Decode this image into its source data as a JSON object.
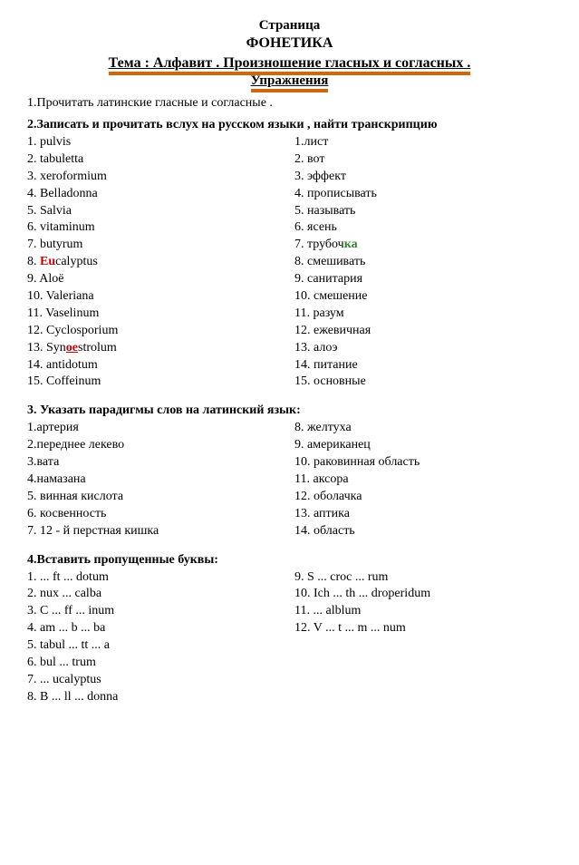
{
  "header": {
    "line1": "Страница",
    "line2": "ФОНЕТИКА",
    "line3": "Тема : Алфавит . Произношение гласных и согласных .",
    "line4": "Упражнения"
  },
  "task1": "1.Прочитать латинские гласные и согласные .",
  "task2": "2.Записать и прочитать вслух на русском языки , найти транскрипцию",
  "list1_left": [
    "1. pulvis",
    "2. tabuletta",
    "3. xeroformium",
    "4. Belladonna",
    "5. Salvia",
    "6. vitaminum",
    "7. butyrum",
    "9. Aloё",
    "10. Valeriana",
    "11. Vaselinum",
    "12. Cyclosporium",
    "14. antidotum",
    "15. Coffeinum"
  ],
  "list1_row8_left": "8. ",
  "list1_row8_r": "Eu",
  "list1_row8_rest": "calyptus",
  "list1_row13_left": "13. Syn",
  "list1_row13_u": "oe",
  "list1_row13_rest": "strolum",
  "list1_right": [
    "1.лист",
    "2. вот",
    "3. эффект",
    "4. прописывать",
    "5. называть",
    "6. ясень",
    "8. смешивать",
    "9. санитария",
    "10. смешение",
    "11. разум",
    "12. ежевичная",
    "13. алоэ",
    "14. питание",
    "15. основные"
  ],
  "list1_row7_right_pre": "7. трубоч",
  "list1_row7_right_g": "ка",
  "task3": "3. Указать парадигмы слов на латинский язык:",
  "list3_left": [
    "1.артерия",
    "2.переднее лекево",
    "3.вата",
    "4.намазана",
    "5. винная кислота",
    "6. косвенность",
    "7. 12 - й перстная кишка"
  ],
  "list3_right": [
    "8. желтуха",
    "9. американец",
    "10. раковинная область",
    "11. аксора",
    "12. оболачка",
    "13. аптика",
    "14. область"
  ],
  "task4": "4.Вставить пропущенные буквы:",
  "list4_left": [
    "1. ... ft ... dotum",
    "2. nux ... calba",
    "3. C ... ff ... inum",
    "4. am ... b ... ba",
    "5. tabul ... tt ... a",
    "6. bul ... trum",
    "7. ... ucalyptus",
    "8. B ... ll ... donna"
  ],
  "list4_right": [
    "9. S ... croc ... rum",
    "10. Ich ... th ... droperidum",
    "11. ... alblum",
    "12. V ... t ... m ... num"
  ]
}
